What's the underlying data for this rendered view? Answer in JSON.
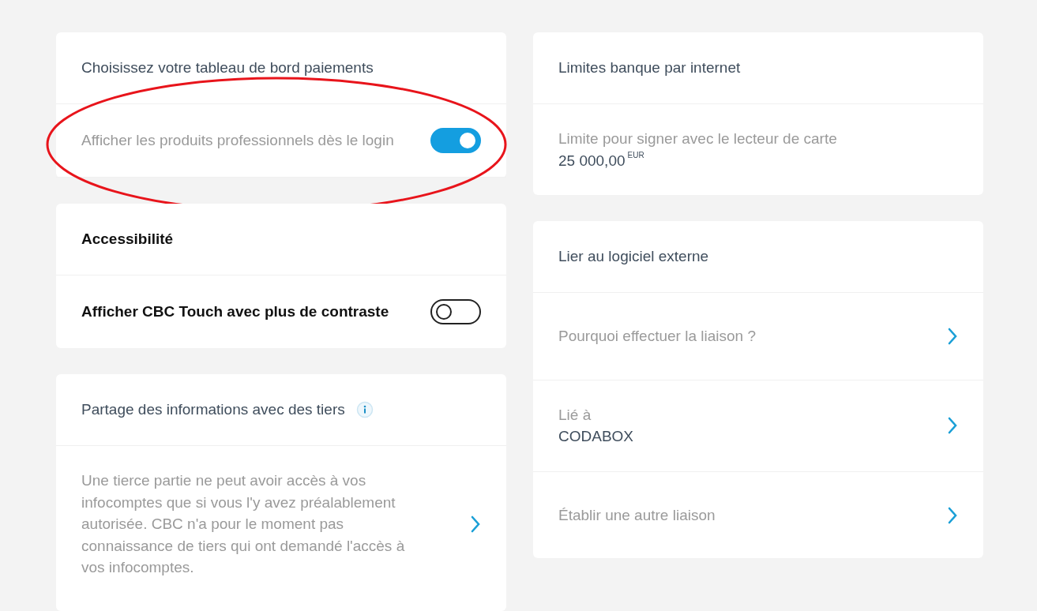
{
  "columns": [
    {
      "cards": [
        {
          "title": "Choisissez votre tableau de bord paiements",
          "highlighted": true,
          "rows": [
            {
              "kind": "toggle",
              "label": "Afficher les produits professionnels dès le login",
              "on": true
            }
          ]
        },
        {
          "title": "Accessibilité",
          "contrast": true,
          "rows": [
            {
              "kind": "toggle",
              "label": "Afficher CBC Touch avec plus de contraste",
              "on": false
            }
          ]
        },
        {
          "title": "Partage des informations avec des tiers",
          "info": true,
          "rows": [
            {
              "kind": "link",
              "label": "Une tierce partie ne peut avoir accès à vos infocomptes que si vous l'y avez préalablement autorisée. CBC n'a pour le moment pas connaissance de tiers qui ont demandé l'accès à vos infocomptes."
            }
          ]
        }
      ]
    },
    {
      "cards": [
        {
          "title": "Limites banque par internet",
          "rows": [
            {
              "kind": "value",
              "label": "Limite pour signer avec le lecteur de carte",
              "value": "25 000,00",
              "unit": "EUR"
            }
          ]
        },
        {
          "title": "Lier au logiciel externe",
          "rows": [
            {
              "kind": "link",
              "label": "Pourquoi effectuer la liaison ?"
            },
            {
              "kind": "value-link",
              "label": "Lié à",
              "value": "CODABOX"
            },
            {
              "kind": "link",
              "label": "Établir une autre liaison"
            }
          ]
        }
      ]
    }
  ]
}
